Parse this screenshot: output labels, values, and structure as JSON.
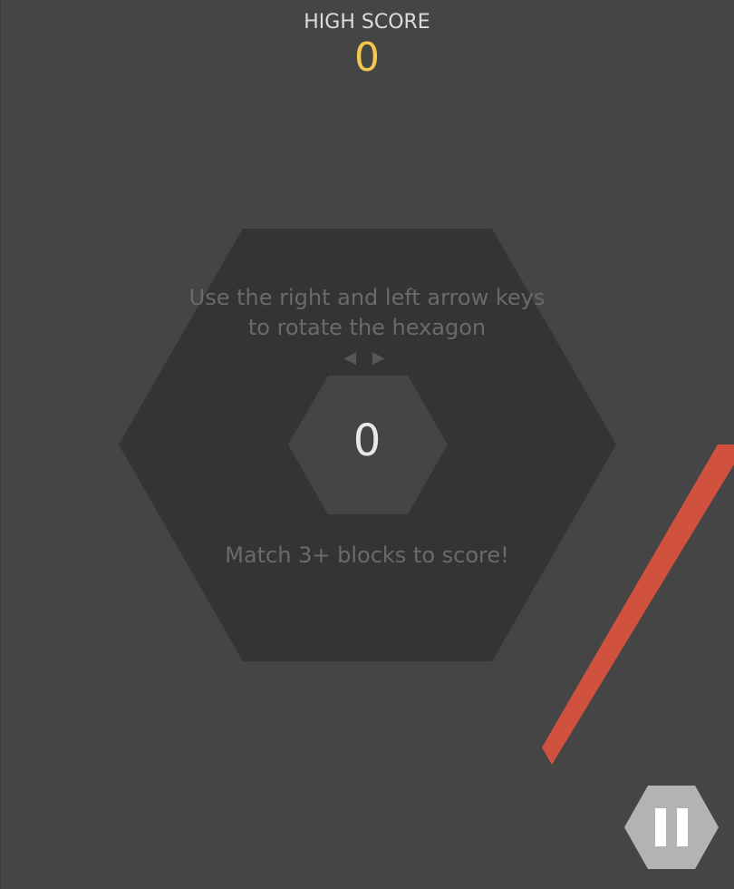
{
  "high_score": {
    "label": "HIGH SCORE",
    "value": "0"
  },
  "instructions": {
    "line1": "Use the right and left arrow keys",
    "line2": "to rotate the hexagon",
    "arrows": "◀ ▶",
    "match_hint": "Match 3+ blocks to score!"
  },
  "score": "0",
  "colors": {
    "background": "#454545",
    "outer_hexagon": "#343434",
    "inner_hexagon": "#454545",
    "high_score_value": "#f2c94c",
    "falling_block": "#d0513d",
    "pause_button": "#b3b3b3"
  },
  "icons": {
    "pause": "pause-icon",
    "left_arrow": "left-arrow-icon",
    "right_arrow": "right-arrow-icon"
  }
}
